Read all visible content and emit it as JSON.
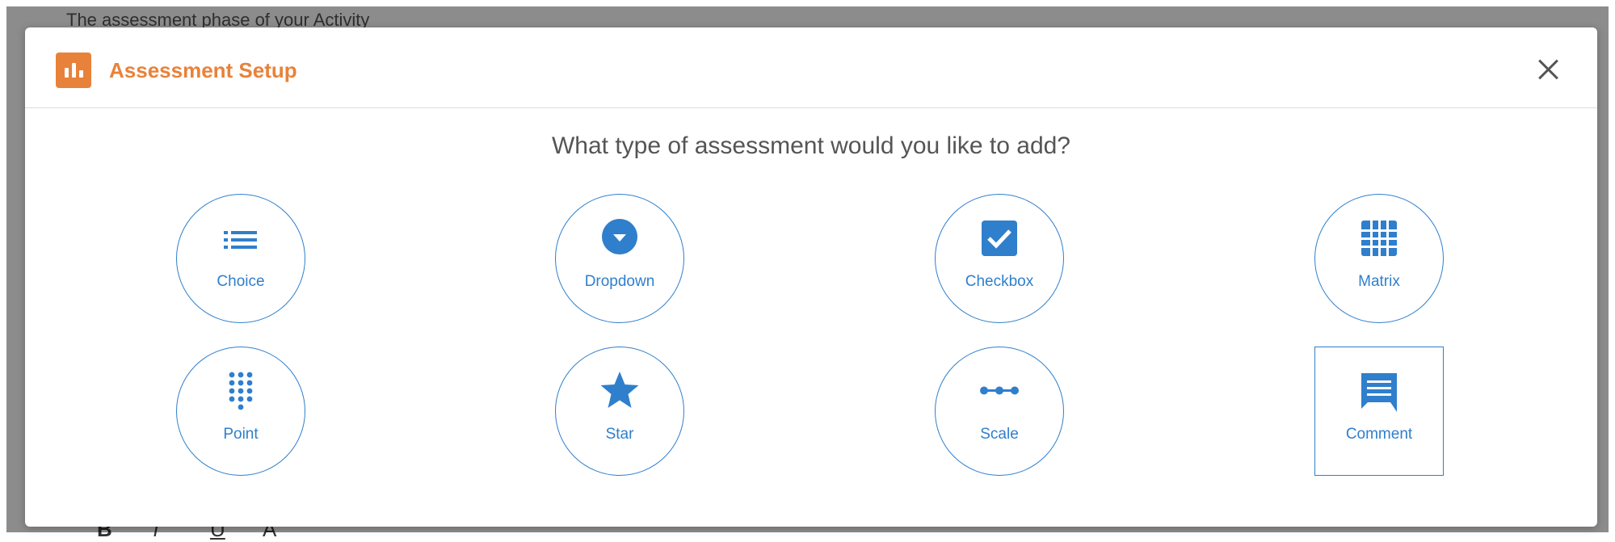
{
  "background": {
    "text": "The assessment phase of your Activity",
    "toolbar": [
      "B",
      "i",
      "U",
      "A"
    ]
  },
  "modal": {
    "title": "Assessment Setup",
    "question": "What type of assessment would you like to add?",
    "options": [
      {
        "label": "Choice",
        "icon": "list-icon"
      },
      {
        "label": "Dropdown",
        "icon": "dropdown-circle-icon"
      },
      {
        "label": "Checkbox",
        "icon": "checkbox-checked-icon"
      },
      {
        "label": "Matrix",
        "icon": "grid-icon"
      },
      {
        "label": "Point",
        "icon": "dialpad-icon"
      },
      {
        "label": "Star",
        "icon": "star-icon"
      },
      {
        "label": "Scale",
        "icon": "scale-dots-icon"
      },
      {
        "label": "Comment",
        "icon": "comment-icon"
      }
    ]
  },
  "colors": {
    "accent_orange": "#e8823a",
    "accent_blue": "#2f7fcc"
  }
}
